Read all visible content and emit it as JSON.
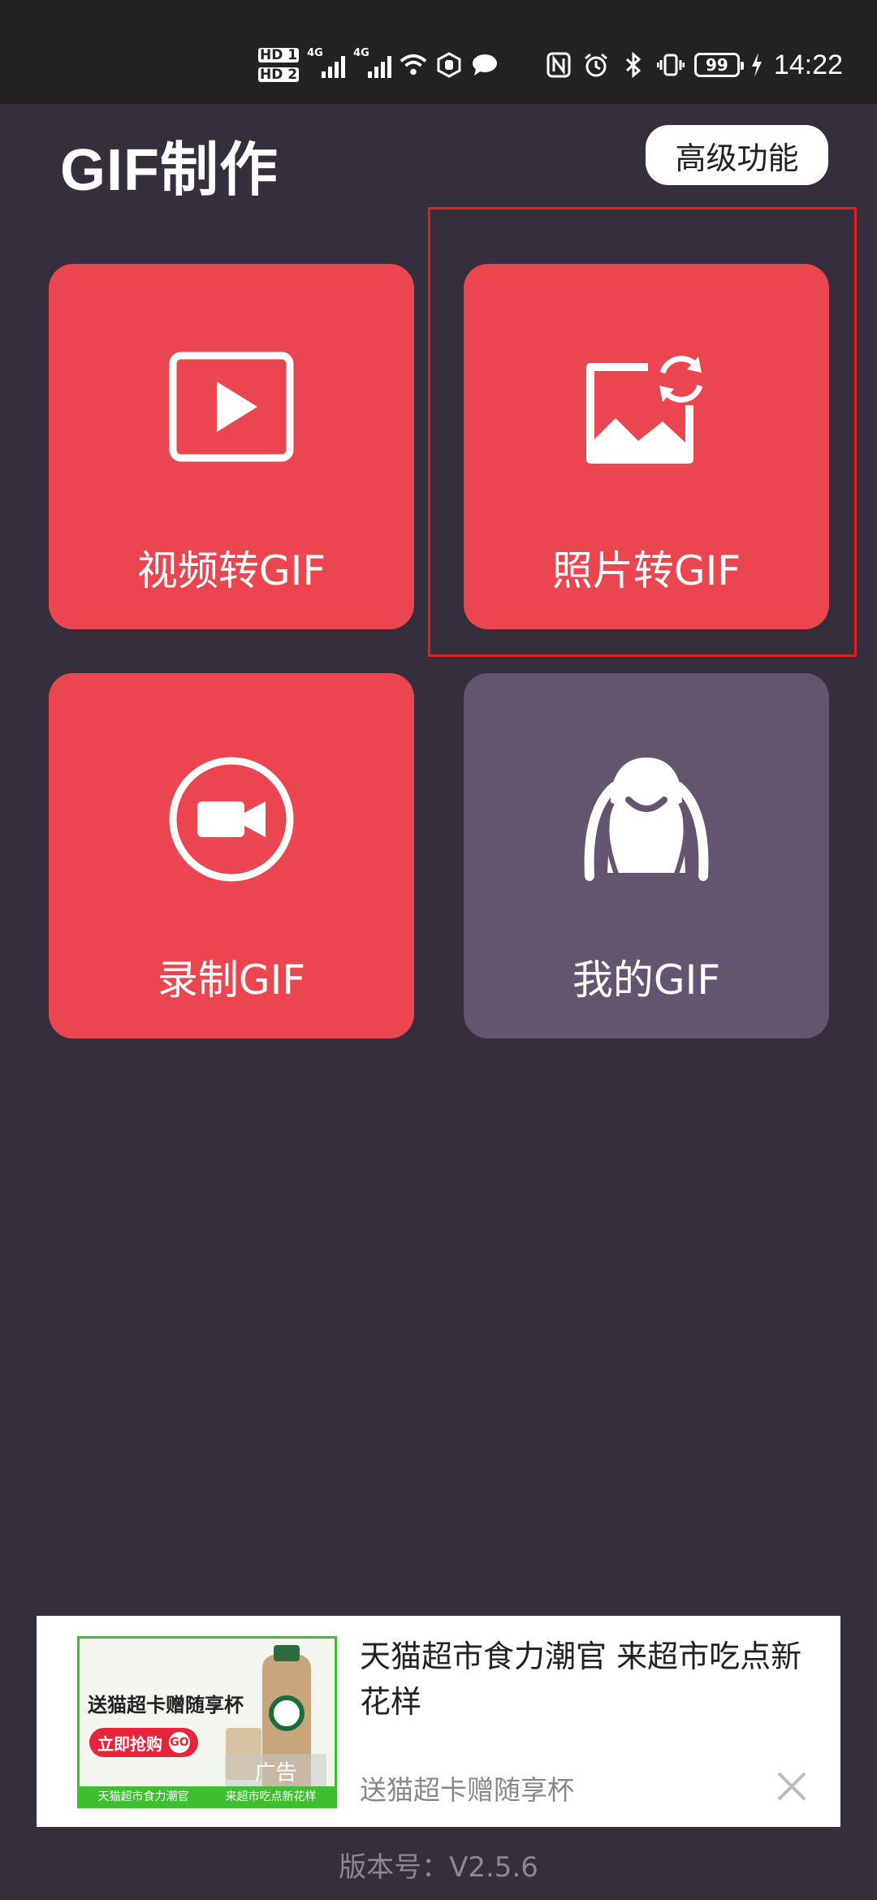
{
  "status_bar": {
    "hd1": "HD 1",
    "hd2": "HD 2",
    "net1": "4G",
    "net2": "4G",
    "battery": "99",
    "time": "14:22"
  },
  "header": {
    "title": "GIF制作",
    "advanced_button": "高级功能"
  },
  "tiles": [
    {
      "label": "视频转GIF",
      "icon": "video-play-icon",
      "color": "#eb4650"
    },
    {
      "label": "照片转GIF",
      "icon": "photo-convert-icon",
      "color": "#eb4650"
    },
    {
      "label": "录制GIF",
      "icon": "record-camera-icon",
      "color": "#eb4650"
    },
    {
      "label": "我的GIF",
      "icon": "mascot-icon",
      "color": "#635570"
    }
  ],
  "ad": {
    "image_text": "送猫超卡赠随享杯",
    "image_button": "立即抢购",
    "image_go": "GO",
    "image_footer_left": "天猫超市食力潮官",
    "image_footer_right": "来超市吃点新花样",
    "image_badge": "广告",
    "title": "天猫超市食力潮官 来超市吃点新花样",
    "subtitle": "送猫超卡赠随享杯"
  },
  "footer": {
    "version": "版本号：V2.5.6"
  },
  "colors": {
    "background": "#342e3d",
    "accent_red": "#eb4650",
    "tile_purple": "#635570",
    "highlight_border": "#e02020"
  }
}
